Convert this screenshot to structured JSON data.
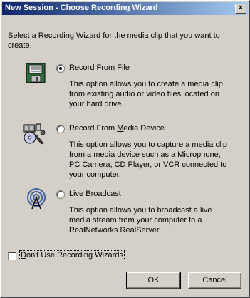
{
  "window": {
    "title": "New Session - Choose Recording Wizard",
    "close_glyph": "×"
  },
  "intro": "Select a Recording Wizard for the media clip that you want to create.",
  "options": [
    {
      "label_before": "Record From ",
      "label_mnemonic": "F",
      "label_after": "ile",
      "selected": true,
      "icon": "disk-icon",
      "description": "This option allows you to create a media clip from existing audio or video files located on your hard drive."
    },
    {
      "label_before": "Record From ",
      "label_mnemonic": "M",
      "label_after": "edia Device",
      "selected": false,
      "icon": "media-device-icon",
      "description": "This option allows you to capture a media clip from a media device such as a Microphone, PC Camera, CD Player, or VCR connected to your computer."
    },
    {
      "label_before": "",
      "label_mnemonic": "L",
      "label_after": "ive Broadcast",
      "selected": false,
      "icon": "broadcast-icon",
      "description": "This option allows you to broadcast a live media stream from your computer to a RealNetworks RealServer."
    }
  ],
  "dont_use": {
    "label_before": "",
    "label_mnemonic": "D",
    "label_after": "on't Use Recording Wizards",
    "checked": false
  },
  "buttons": {
    "ok": "OK",
    "cancel": "Cancel"
  }
}
